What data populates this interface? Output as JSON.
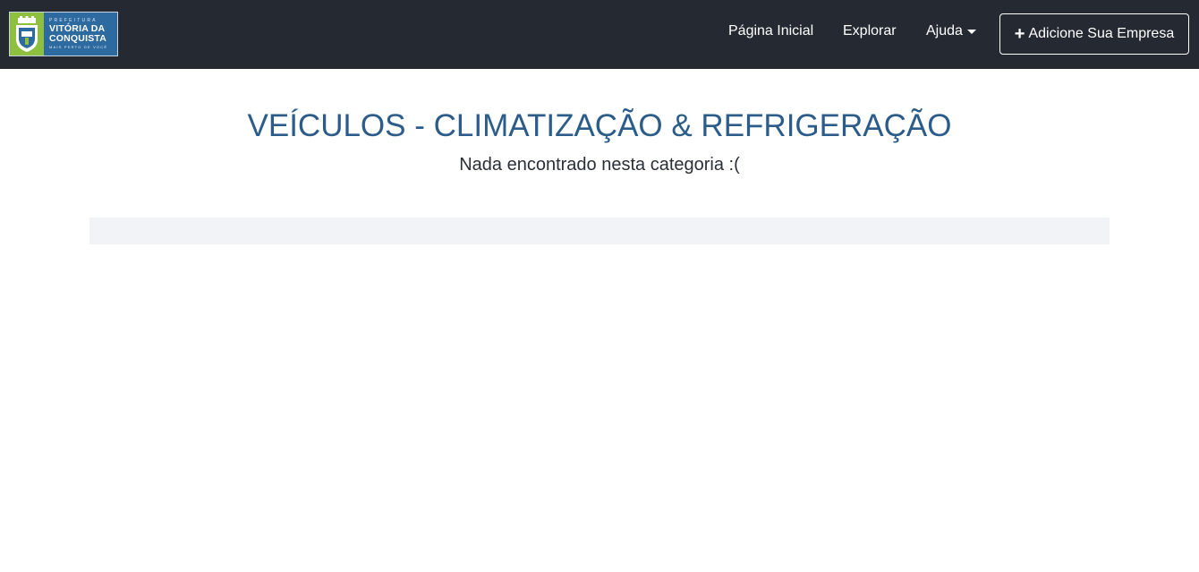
{
  "header": {
    "logo": {
      "top": "PREFEITURA",
      "line1": "VITÓRIA DA",
      "line2": "CONQUISTA",
      "tagline": "MAIS PERTO DE VOCÊ",
      "crest_icon": "city-crest-icon"
    },
    "nav": {
      "home": "Página Inicial",
      "explore": "Explorar",
      "help": "Ajuda",
      "help_icon": "caret-down-icon"
    },
    "add_button": {
      "icon": "plus-icon",
      "label": "Adicione Sua Empresa"
    }
  },
  "main": {
    "title": "VEÍCULOS - CLIMATIZAÇÃO & REFRIGERAÇÃO",
    "message": "Nada encontrado nesta categoria :("
  },
  "colors": {
    "navbar": "#242932",
    "title": "#2c5d8a",
    "logo_blue": "#2d6aa0",
    "logo_green": "#8fbf3f",
    "results_bar": "#f2f3f6"
  }
}
